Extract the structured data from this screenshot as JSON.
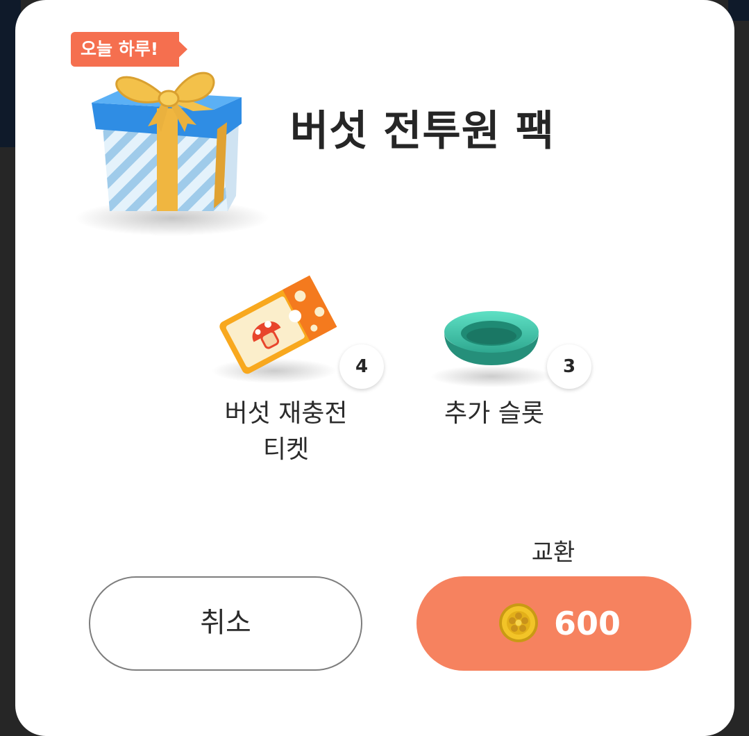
{
  "badge": {
    "text": "오늘 하루!"
  },
  "pack": {
    "title": "버섯 전투원 팩",
    "icon": "gift-box-icon"
  },
  "items": [
    {
      "name_line1": "버섯 재충전",
      "name_line2": "티켓",
      "count": "4",
      "icon": "mushroom-ticket-icon"
    },
    {
      "name_line1": "추가 슬롯",
      "name_line2": "",
      "count": "3",
      "icon": "teal-slot-dish-icon"
    }
  ],
  "actions": {
    "exchange_label": "교환",
    "cancel_label": "취소",
    "price": "600",
    "currency_icon": "gold-coin-icon"
  },
  "colors": {
    "accent": "#f6825f",
    "badge": "#f56f4f",
    "dialog_bg": "#ffffff",
    "backdrop": "#262626"
  }
}
